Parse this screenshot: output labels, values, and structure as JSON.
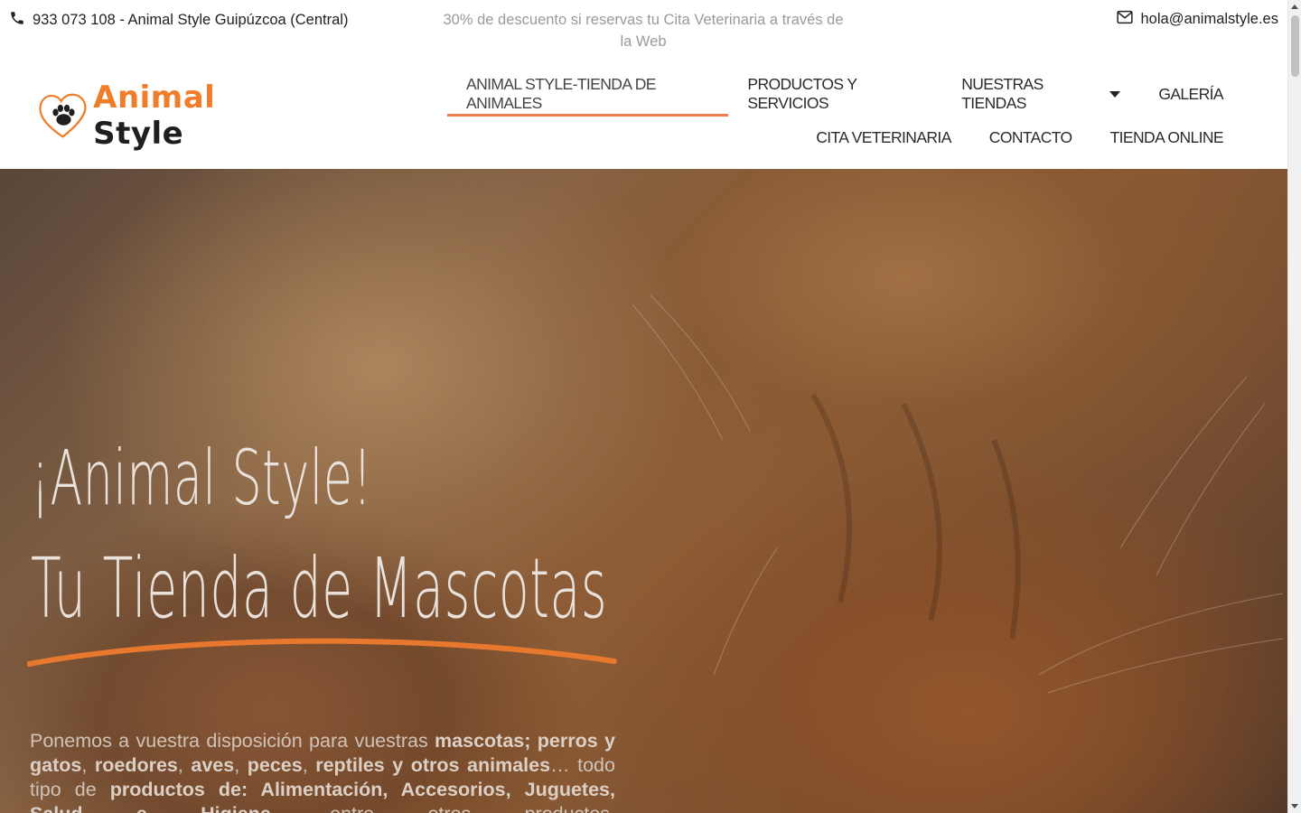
{
  "topbar": {
    "phone_text": "933 073 108 - Animal Style Guipúzcoa (Central)",
    "promo_text": "30% de descuento si reservas tu Cita Veterinaria a través de la Web",
    "email_text": "hola@animalstyle.es"
  },
  "logo": {
    "word1": "Animal",
    "word2": "Style"
  },
  "nav": {
    "row1": [
      {
        "label": "ANIMAL STYLE-TIENDA DE ANIMALES"
      },
      {
        "label": "PRODUCTOS Y SERVICIOS"
      },
      {
        "label": "NUESTRAS TIENDAS"
      },
      {
        "label": "GALERÍA"
      }
    ],
    "row2": [
      {
        "label": "CITA VETERINARIA"
      },
      {
        "label": "CONTACTO"
      },
      {
        "label": "TIENDA ONLINE"
      }
    ]
  },
  "hero": {
    "title_line1": "¡Animal Style!",
    "title_line2": "Tu Tienda de Mascotas",
    "desc": {
      "p1": "Ponemos a vuestra disposición para vuestras ",
      "b1": "mascotas; perros y gatos",
      "p2": ", ",
      "b2": "roedores",
      "p3": ", ",
      "b3": "aves",
      "p4": ", ",
      "b4": "peces",
      "p5": ", ",
      "b5": "reptiles y otros animales",
      "p6": "… todo tipo de ",
      "b6": "productos de: Alimentación, Accesorios, Juguetes, Salud e Higiene",
      "p7": ", entre otros productos."
    }
  },
  "colors": {
    "accent": "#f07d45",
    "logo_orange": "#f07d2a"
  },
  "icons": {
    "phone": "phone-icon",
    "mail": "envelope-icon",
    "caret": "caret-down-icon"
  }
}
